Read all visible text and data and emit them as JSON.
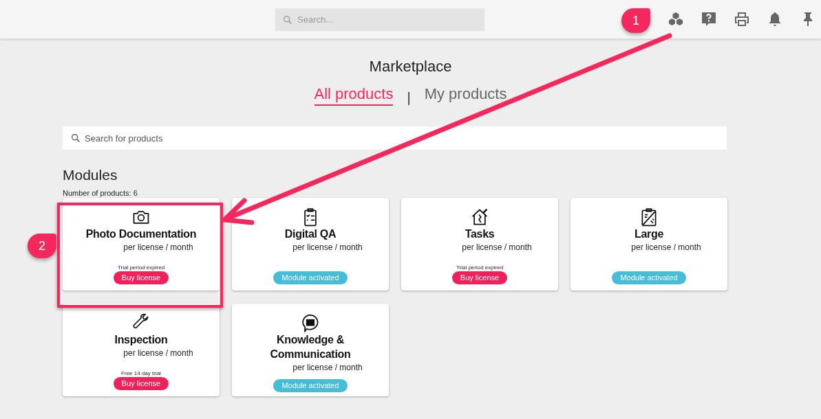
{
  "topbar": {
    "search": {
      "placeholder": "Search..."
    }
  },
  "title": "Marketplace",
  "tabs": [
    {
      "label": "All products",
      "selected": true
    },
    {
      "label": "My products",
      "selected": false
    }
  ],
  "tab_separator": "|",
  "product_search": {
    "placeholder": "Search for products"
  },
  "section": {
    "heading": "Modules",
    "count": "Number of products: 6"
  },
  "products": [
    {
      "name": "Photo Documentation",
      "price": "per license / month",
      "note": "Trial period expired",
      "action": {
        "kind": "buy",
        "label": "Buy license"
      }
    },
    {
      "name": "Digital QA",
      "price": "per license / month",
      "action": {
        "kind": "activated",
        "label": "Module activated"
      }
    },
    {
      "name": "Tasks",
      "price": "per license / month",
      "note": "Trial period expired",
      "action": {
        "kind": "buy",
        "label": "Buy license"
      }
    },
    {
      "name": "Large",
      "price": "per license / month",
      "action": {
        "kind": "activated",
        "label": "Module activated"
      }
    },
    {
      "name": "Inspection",
      "price": "per license / month",
      "note": "Free 14 day trial",
      "action": {
        "kind": "buy",
        "label": "Buy license"
      }
    },
    {
      "name": "Knowledge & Communication",
      "price": "per license / month",
      "action": {
        "kind": "activated",
        "label": "Module activated"
      }
    }
  ],
  "callouts": [
    {
      "label": "1"
    },
    {
      "label": "2"
    }
  ]
}
